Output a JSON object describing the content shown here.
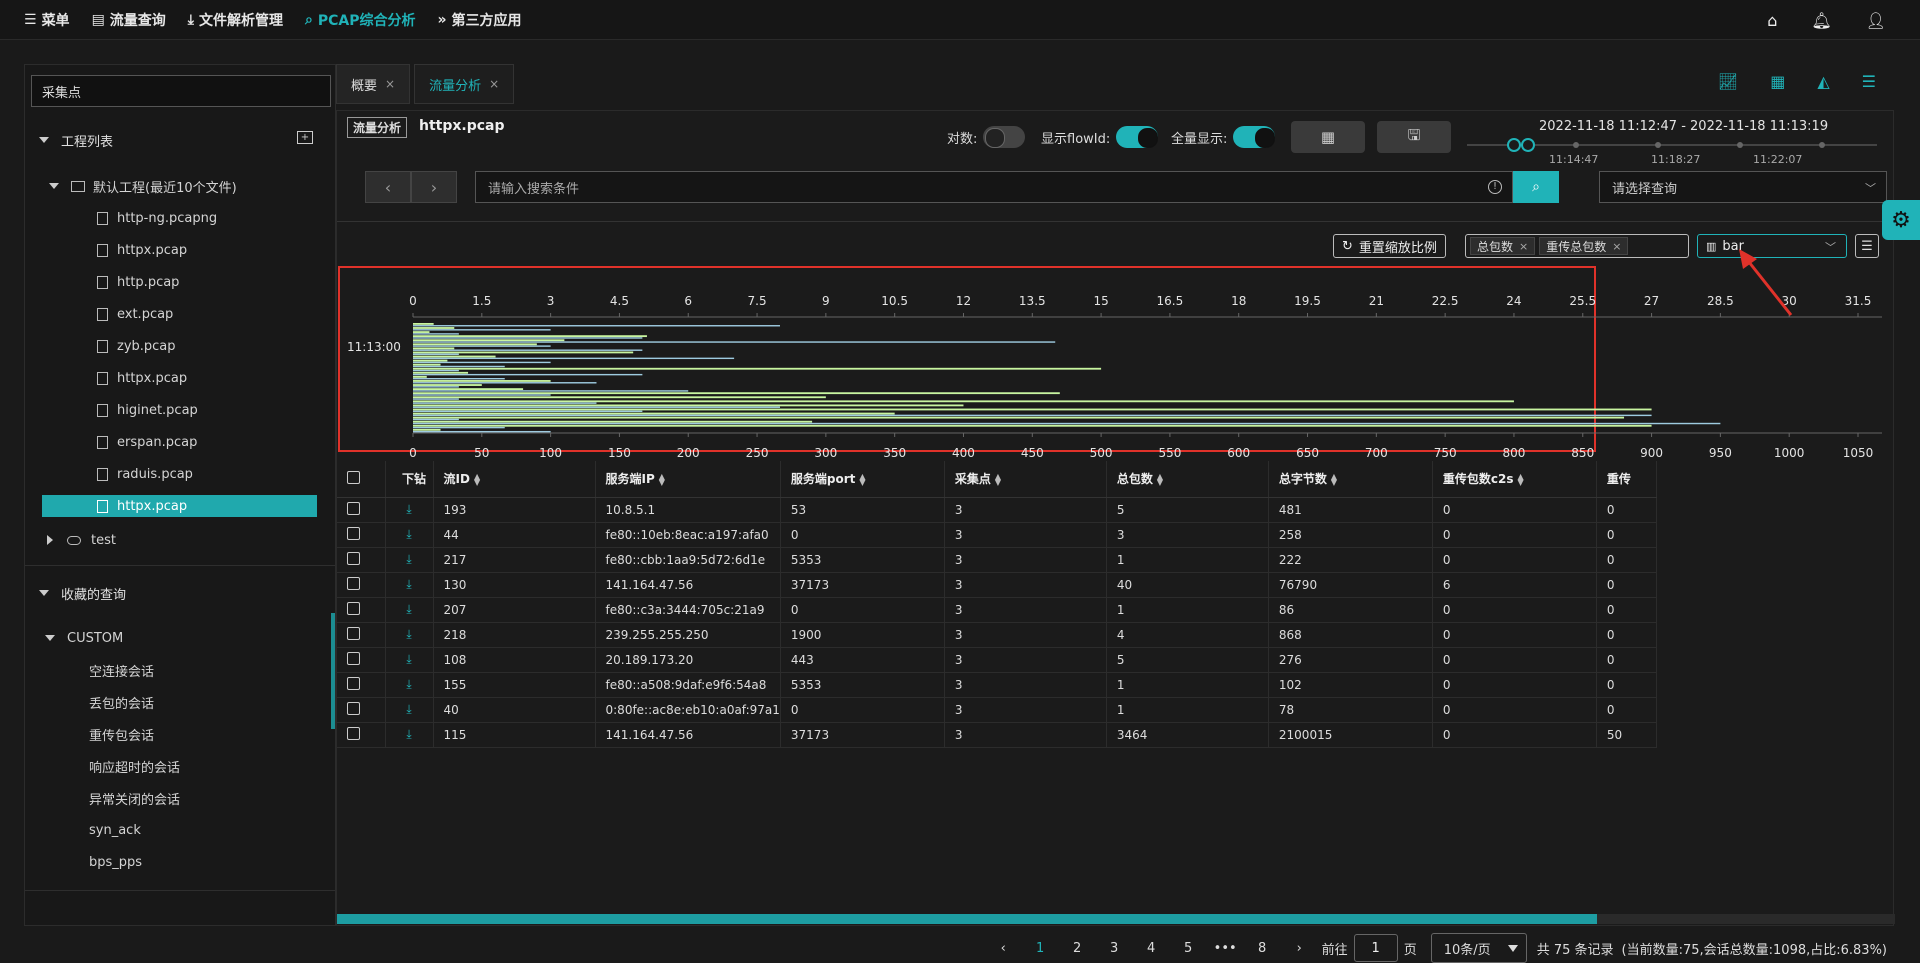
{
  "topnav": {
    "items": [
      {
        "label": "菜单",
        "icon": "menu-icon",
        "glyph": "☰"
      },
      {
        "label": "流量查询",
        "icon": "document-icon",
        "glyph": "▤"
      },
      {
        "label": "文件解析管理",
        "icon": "upload-icon",
        "glyph": "⤓"
      },
      {
        "label": "PCAP综合分析",
        "icon": "search-icon",
        "glyph": "⌕",
        "active": true
      },
      {
        "label": "第三方应用",
        "icon": "double-chevron-icon",
        "glyph": "»"
      }
    ]
  },
  "sidebar": {
    "search_value": "采集点",
    "project_list_title": "工程列表",
    "default_project": "默认工程(最近10个文件)",
    "files": [
      "http-ng.pcapng",
      "httpx.pcap",
      "http.pcap",
      "ext.pcap",
      "zyb.pcap",
      "httpx.pcap",
      "higinet.pcap",
      "erspan.pcap",
      "raduis.pcap",
      "httpx.pcap"
    ],
    "selected_index": 9,
    "test_project": "test",
    "favorites_title": "收藏的查询",
    "custom_title": "CUSTOM",
    "queries": [
      "空连接会话",
      "丢包的会话",
      "重传包会话",
      "响应超时的会话",
      "异常关闭的会话",
      "syn_ack",
      "bps_pps"
    ]
  },
  "tabs": [
    {
      "label": "概要",
      "active": false
    },
    {
      "label": "流量分析",
      "active": true
    }
  ],
  "panel": {
    "tag": "流量分析",
    "filename": "httpx.pcap",
    "switch_log_label": "对数:",
    "switch_flowid_label": "显示flowId:",
    "switch_full_label": "全量显示:",
    "time_range": "2022-11-18 11:12:47 - 2022-11-18 11:13:19",
    "time_ticks": [
      "11:14:47",
      "11:18:27",
      "11:22:07"
    ],
    "search_placeholder": "请输入搜索条件",
    "select_placeholder": "请选择查询",
    "reset_label": "重置缩放比例",
    "chips": [
      "总包数",
      "重传总包数"
    ],
    "chart_type": "bar"
  },
  "chart_data": {
    "type": "bar",
    "orientation": "horizontal",
    "ylabel_tick": "11:13:00",
    "top_axis_ticks": [
      "0",
      "1.5",
      "3",
      "4.5",
      "6",
      "7.5",
      "9",
      "10.5",
      "12",
      "13.5",
      "15",
      "16.5",
      "18",
      "19.5",
      "21",
      "22.5",
      "24",
      "25.5",
      "27",
      "28.5",
      "30",
      "31.5"
    ],
    "bottom_axis_ticks": [
      "0",
      "50",
      "100",
      "150",
      "200",
      "250",
      "300",
      "350",
      "400",
      "450",
      "500",
      "550",
      "600",
      "650",
      "700",
      "750",
      "800",
      "850",
      "900",
      "950",
      "1000",
      "1050"
    ],
    "top_range": [
      0,
      31.5
    ],
    "bottom_range": [
      0,
      1050
    ],
    "series": [
      {
        "color": "#9ecbe0",
        "values": [
          8,
          3,
          1,
          5,
          14,
          3,
          5,
          1,
          7,
          3,
          2,
          1,
          5,
          2,
          4,
          1,
          6,
          3,
          1,
          4,
          8,
          5,
          27,
          1,
          28.5,
          2,
          3
        ]
      },
      {
        "color": "#c8f5a0",
        "values": [
          15,
          30,
          12,
          170,
          110,
          90,
          30,
          160,
          60,
          25,
          20,
          500,
          40,
          10,
          100,
          50,
          80,
          470,
          300,
          800,
          400,
          900,
          350,
          880,
          290,
          900,
          20
        ]
      }
    ]
  },
  "table": {
    "columns": [
      "下钻",
      "流ID",
      "服务端IP",
      "服务端port",
      "采集点",
      "总包数",
      "总字节数",
      "重传包数c2s",
      "重传"
    ],
    "rows": [
      [
        "193",
        "10.8.5.1",
        "53",
        "3",
        "5",
        "481",
        "0",
        "0"
      ],
      [
        "44",
        "fe80::10eb:8eac:a197:afa0",
        "0",
        "3",
        "3",
        "258",
        "0",
        "0"
      ],
      [
        "217",
        "fe80::cbb:1aa9:5d72:6d1e",
        "5353",
        "3",
        "1",
        "222",
        "0",
        "0"
      ],
      [
        "130",
        "141.164.47.56",
        "37173",
        "3",
        "40",
        "76790",
        "6",
        "0"
      ],
      [
        "207",
        "fe80::c3a:3444:705c:21a9",
        "0",
        "3",
        "1",
        "86",
        "0",
        "0"
      ],
      [
        "218",
        "239.255.255.250",
        "1900",
        "3",
        "4",
        "868",
        "0",
        "0"
      ],
      [
        "108",
        "20.189.173.20",
        "443",
        "3",
        "5",
        "276",
        "0",
        "0"
      ],
      [
        "155",
        "fe80::a508:9daf:e9f6:54a8",
        "5353",
        "3",
        "1",
        "102",
        "0",
        "0"
      ],
      [
        "40",
        "0:80fe::ac8e:eb10:a0af:97a1",
        "0",
        "3",
        "1",
        "78",
        "0",
        "0"
      ],
      [
        "115",
        "141.164.47.56",
        "37173",
        "3",
        "3464",
        "2100015",
        "0",
        "50"
      ]
    ]
  },
  "pager": {
    "pages": [
      "1",
      "2",
      "3",
      "4",
      "5",
      "•••",
      "8"
    ],
    "goto_label": "前往",
    "goto_value": "1",
    "page_unit": "页",
    "page_size": "10条/页",
    "total": "共 75 条记录",
    "summary": "(当前数量:75,会话总数量:1098,占比:6.83%)"
  }
}
